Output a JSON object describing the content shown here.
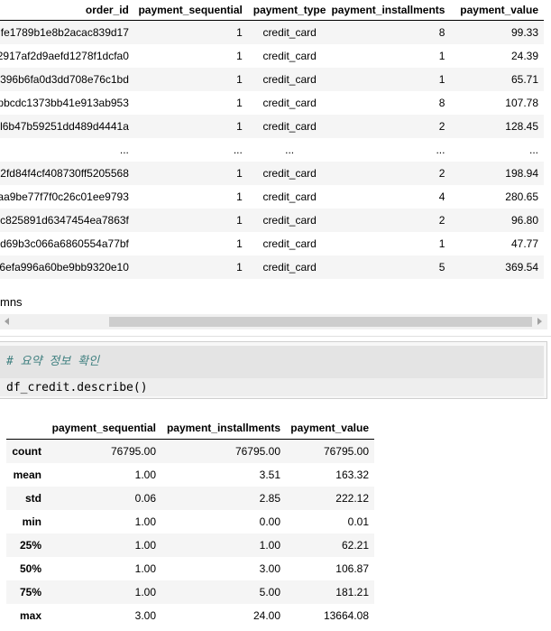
{
  "top_table": {
    "columns": [
      "order_id",
      "payment_sequential",
      "payment_type",
      "payment_installments",
      "payment_value"
    ],
    "rows": [
      [
        "fe1789b1e8b2acac839d17",
        "1",
        "credit_card",
        "8",
        "99.33"
      ],
      [
        "2917af2d9aefd1278f1dcfa0",
        "1",
        "credit_card",
        "1",
        "24.39"
      ],
      [
        "396b6fa0d3dd708e76c1bd",
        "1",
        "credit_card",
        "1",
        "65.71"
      ],
      [
        "pbcdc1373bb41e913ab953",
        "1",
        "credit_card",
        "8",
        "107.78"
      ],
      [
        "l6b47b59251dd489d4441a",
        "1",
        "credit_card",
        "2",
        "128.45"
      ],
      [
        "...",
        "...",
        "...",
        "...",
        "..."
      ],
      [
        "2fd84f4cf408730ff5205568",
        "1",
        "credit_card",
        "2",
        "198.94"
      ],
      [
        "aa9be77f7f0c26c01ee9793",
        "1",
        "credit_card",
        "4",
        "280.65"
      ],
      [
        "c825891d6347454ea7863f",
        "1",
        "credit_card",
        "2",
        "96.80"
      ],
      [
        "d69b3c066a6860554a77bf",
        "1",
        "credit_card",
        "1",
        "47.77"
      ],
      [
        "6efa996a60be9bb9320e10",
        "1",
        "credit_card",
        "5",
        "369.54"
      ]
    ]
  },
  "columns_note": "mns",
  "code_cell": {
    "comment": "# 요약 정보 확인",
    "code": "df_credit.describe()"
  },
  "describe_table": {
    "columns": [
      "",
      "payment_sequential",
      "payment_installments",
      "payment_value"
    ],
    "rows": [
      [
        "count",
        "76795.00",
        "76795.00",
        "76795.00"
      ],
      [
        "mean",
        "1.00",
        "3.51",
        "163.32"
      ],
      [
        "std",
        "0.06",
        "2.85",
        "222.12"
      ],
      [
        "min",
        "1.00",
        "0.00",
        "0.01"
      ],
      [
        "25%",
        "1.00",
        "1.00",
        "62.21"
      ],
      [
        "50%",
        "1.00",
        "3.00",
        "106.87"
      ],
      [
        "75%",
        "1.00",
        "5.00",
        "181.21"
      ],
      [
        "max",
        "3.00",
        "24.00",
        "13664.08"
      ]
    ]
  }
}
